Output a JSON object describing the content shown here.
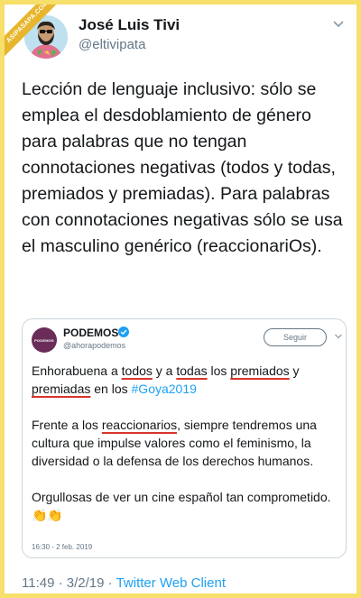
{
  "watermark": "ASIPASAPA.COM",
  "author": {
    "name": "José Luis Tivi",
    "handle": "@eltivipata"
  },
  "tweet_text": "Lección de lenguaje inclusivo: sólo se emplea el desdoblamiento de género para palabras que no tengan connotaciones negativas (todos y todas, premiados y premiadas). Para palabras con connotaciones negativas sólo se usa el masculino genérico (reaccionariOs).",
  "quoted": {
    "avatar_label": "PODEMOS",
    "name": "PODEMOS",
    "handle": "@ahorapodemos",
    "follow_label": "Seguir",
    "p1": {
      "a": "Enhorabuena a ",
      "todos": "todos",
      "b": " y a ",
      "todas": "todas",
      "c": " los ",
      "premiados": "premiados",
      "d": " y ",
      "premiadas": "premiadas",
      "e": " en los ",
      "hashtag": "#Goya2019"
    },
    "p2": {
      "a": "Frente a los ",
      "reaccionarios": "reaccionarios",
      "b": ", siempre tendremos una cultura que impulse valores como el feminismo, la diversidad o la defensa de los derechos humanos."
    },
    "p3": "Orgullosas de ver un cine español tan comprometido. 👏👏",
    "timestamp": "16:30 - 2 feb. 2019"
  },
  "footer": {
    "time": "11:49",
    "sep1": " · ",
    "date": "3/2/19",
    "sep2": " · ",
    "client": "Twitter Web Client"
  },
  "colors": {
    "background": "#f6df6a",
    "link": "#1da1f2",
    "underline": "#d8342c",
    "podemos": "#6a2c58"
  },
  "icons": [
    "chevron-down-icon",
    "verified-badge-icon"
  ]
}
